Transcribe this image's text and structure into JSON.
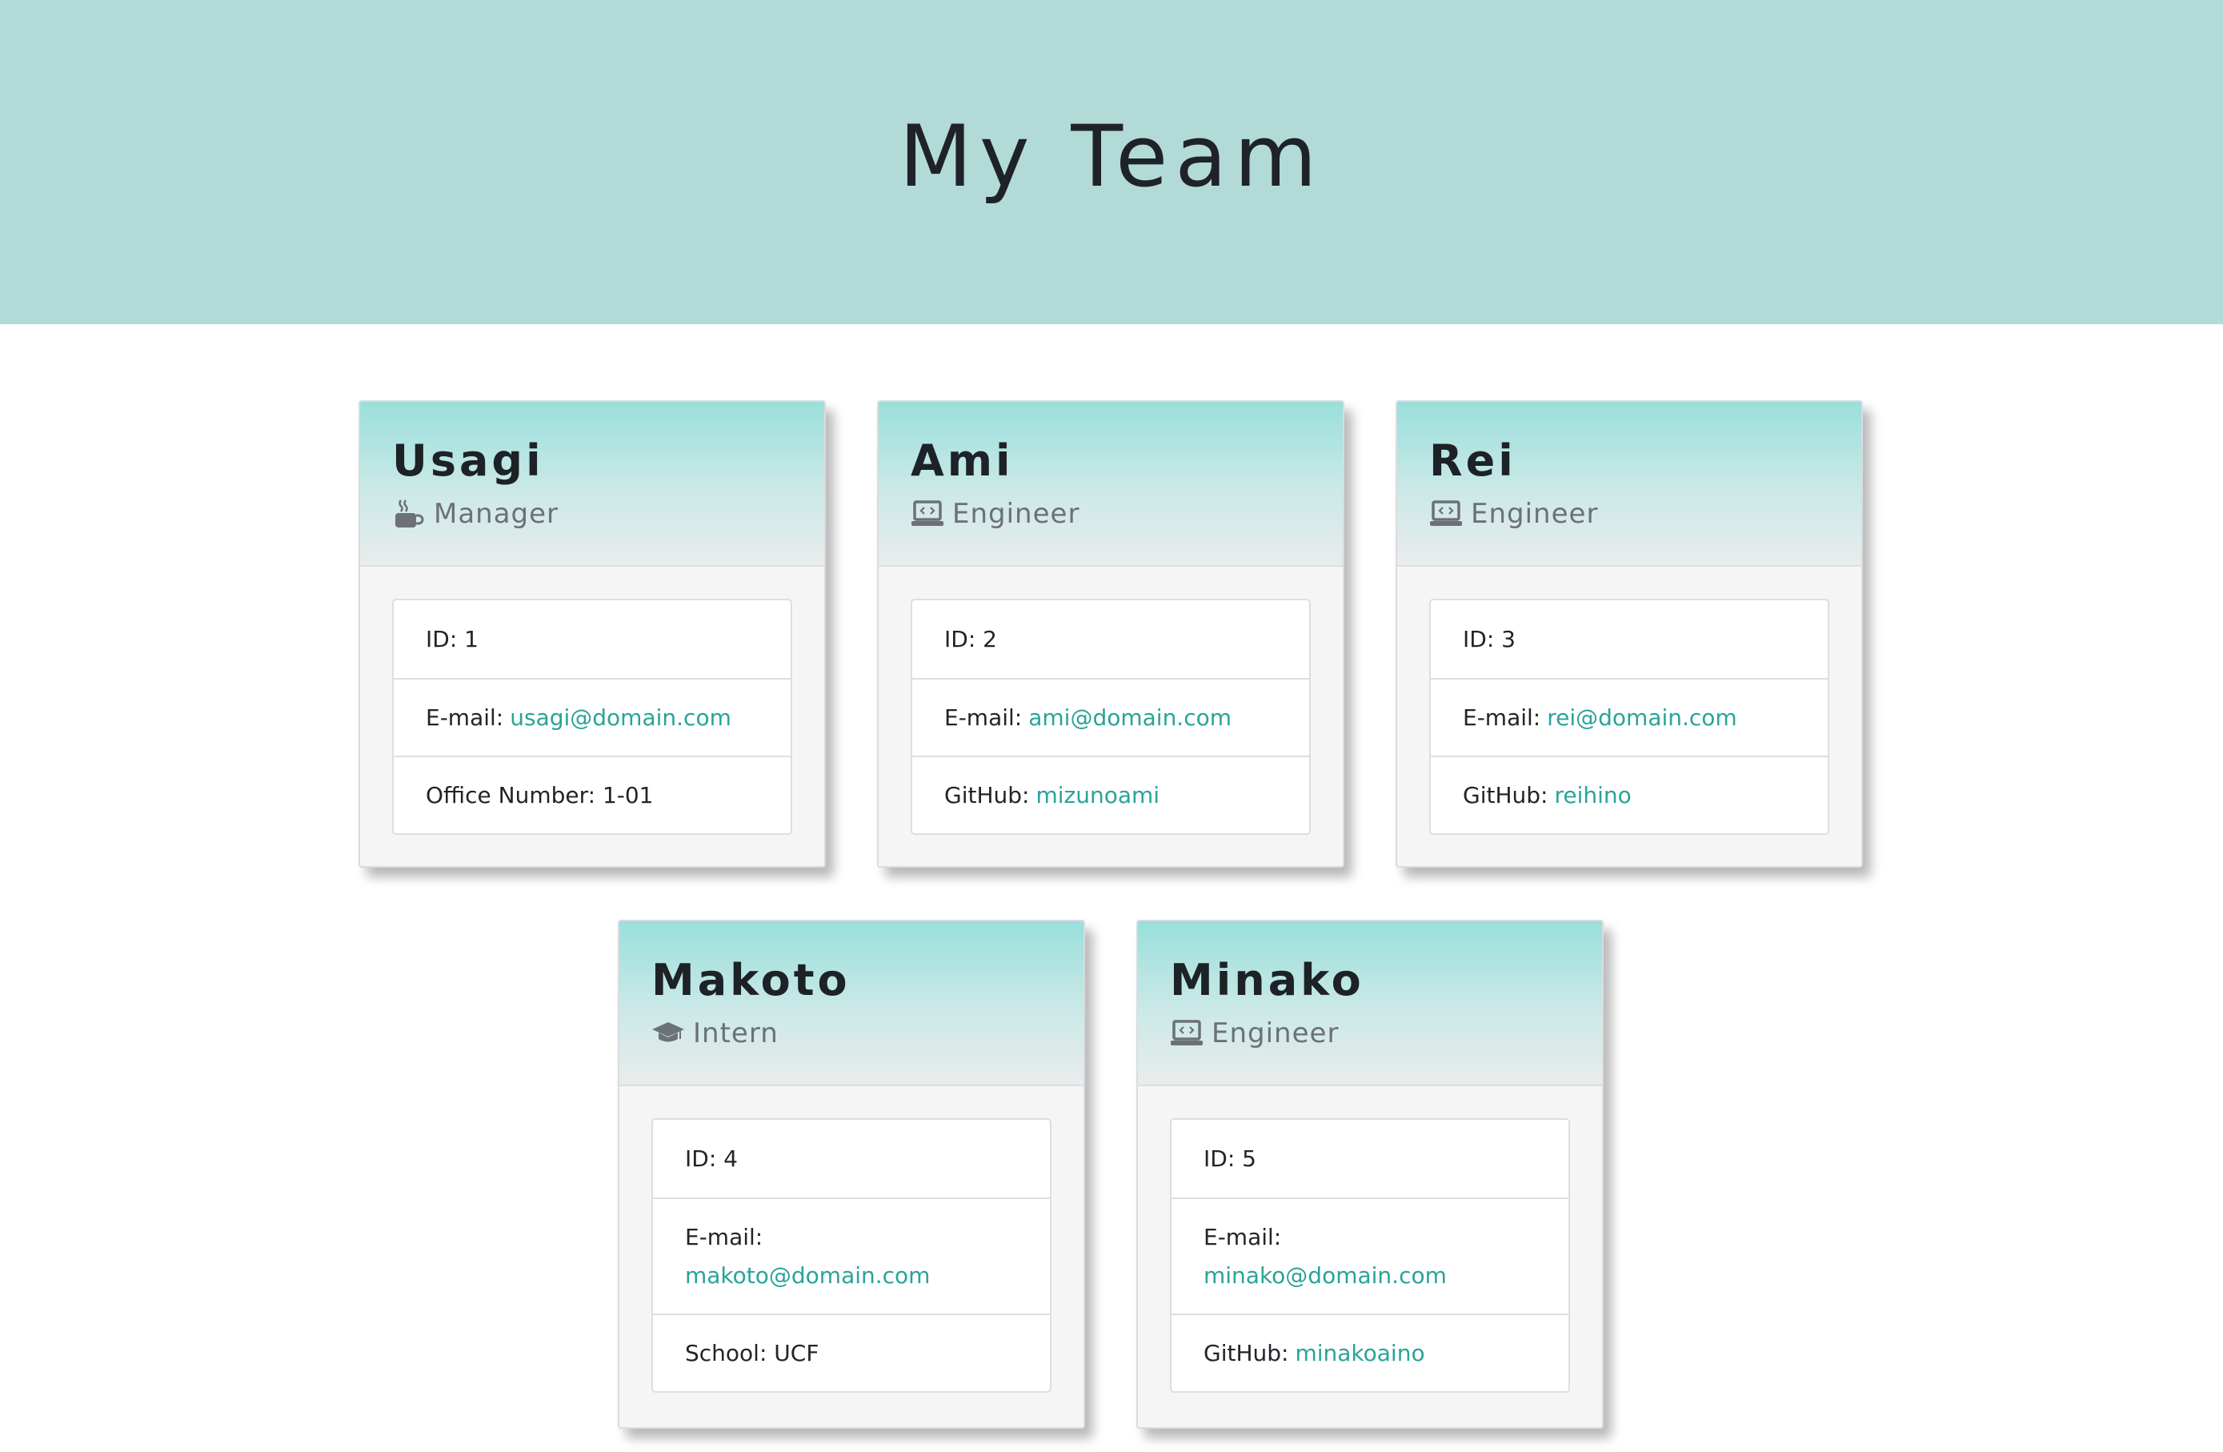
{
  "page": {
    "title": "My Team"
  },
  "colors": {
    "banner": "#b2dbd8",
    "link": "#2aa39a",
    "header_gradient_top": "#9adfdb"
  },
  "team": [
    {
      "name": "Usagi",
      "role": "Manager",
      "role_icon": "coffee-mug-icon",
      "id_label": "ID: 1",
      "email_label": "E-mail:",
      "email": "usagi@domain.com",
      "extra_label": "Office Number: 1-01",
      "extra_value": ""
    },
    {
      "name": "Ami",
      "role": "Engineer",
      "role_icon": "laptop-code-icon",
      "id_label": "ID: 2",
      "email_label": "E-mail:",
      "email": "ami@domain.com",
      "extra_label": "GitHub:",
      "extra_value": "mizunoami"
    },
    {
      "name": "Rei",
      "role": "Engineer",
      "role_icon": "laptop-code-icon",
      "id_label": "ID: 3",
      "email_label": "E-mail:",
      "email": "rei@domain.com",
      "extra_label": "GitHub:",
      "extra_value": "reihino"
    },
    {
      "name": "Makoto",
      "role": "Intern",
      "role_icon": "graduation-cap-icon",
      "id_label": "ID: 4",
      "email_label": "E-mail:",
      "email": "makoto@domain.com",
      "extra_label": "School: UCF",
      "extra_value": ""
    },
    {
      "name": "Minako",
      "role": "Engineer",
      "role_icon": "laptop-code-icon",
      "id_label": "ID: 5",
      "email_label": "E-mail:",
      "email": "minako@domain.com",
      "extra_label": "GitHub:",
      "extra_value": "minakoaino"
    }
  ]
}
